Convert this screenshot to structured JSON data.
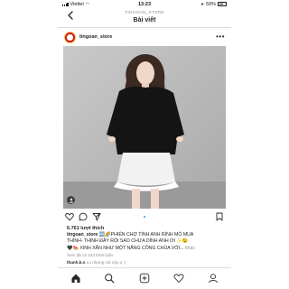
{
  "status_bar": {
    "carrier": "Viettel",
    "time": "13:23",
    "battery": "59%",
    "battery_fraction": 0.59
  },
  "nav": {
    "username": "TINGOAN_STORE",
    "title": "Bài viết",
    "back_icon": "chevron-left-icon"
  },
  "post": {
    "username": "tingoan_store",
    "more_icon": "ellipsis-icon",
    "photo_icon": "user-tag-icon"
  },
  "actions": {
    "icons": [
      "heart-icon",
      "comment-icon",
      "share-icon",
      "bookmark-icon"
    ],
    "carousel_dots": 1
  },
  "likes": "6.761 lượt thích",
  "caption": {
    "username": "tingoan_store",
    "line1": " 🆕🌈PHIÊN CHỢ TÌNH ANH RÌNH MÒ MUA",
    "line2": "THÍNH- THÍNH ĐẦY RỒI SAO CHƯA DÍNH ANH ƠI ✨😉",
    "line3": "🖤🍉 XINH XẮN NHƯ MỘT NẮNG CÔNG CHÚA VỚI...",
    "more": "khác"
  },
  "comments_link": "Xem tất cả 234 bình luận",
  "comment_peek": {
    "user": "thanh.b.s",
    "text": "Lo nhưng cái này ạ :)"
  },
  "tabbar": {
    "icons": [
      "home-icon",
      "search-icon",
      "add-post-icon",
      "activity-heart-icon",
      "profile-icon"
    ]
  },
  "colors": {
    "accent": "#3897f0",
    "avatar_bg": "#d11f26",
    "text": "#262626",
    "muted": "#8e8e8e"
  }
}
